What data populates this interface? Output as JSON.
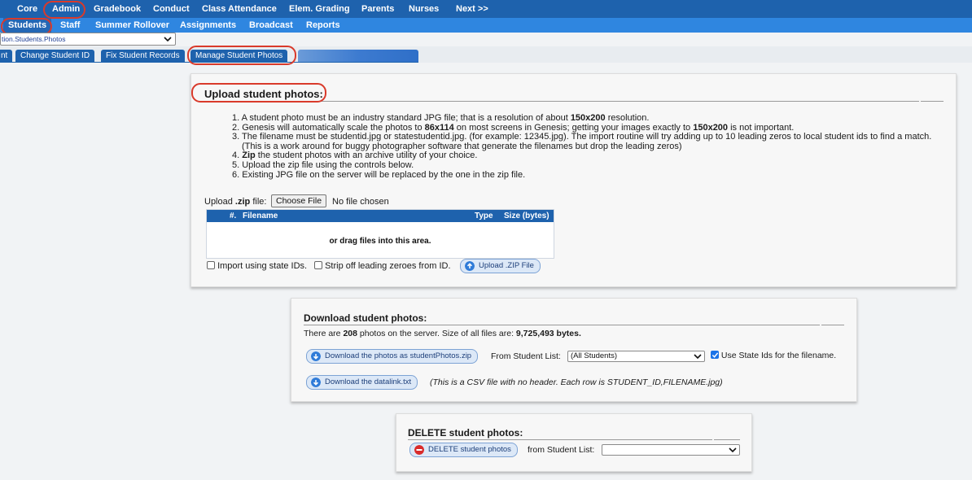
{
  "topnav": {
    "items": [
      "Core",
      "Admin",
      "Gradebook",
      "Conduct",
      "Class Attendance",
      "Elem. Grading",
      "Parents",
      "Nurses",
      "Next >>"
    ]
  },
  "subnav": {
    "items": [
      "Students",
      "Staff",
      "Summer Rollover",
      "Assignments",
      "Broadcast",
      "Reports"
    ]
  },
  "page_select": {
    "value": "tion.Students.Photos"
  },
  "tabs": [
    "nt",
    "Change Student ID",
    "Fix Student Records",
    "Manage Student Photos"
  ],
  "upload": {
    "title": "Upload student photos:",
    "rules": [
      {
        "n": "1. ",
        "parts": [
          [
            "A student photo must be an industry standard JPG file; that is a resolution of about ",
            false
          ],
          [
            "150x200",
            true
          ],
          [
            " resolution.",
            false
          ]
        ]
      },
      {
        "n": "2. ",
        "parts": [
          [
            "Genesis will automatically scale the photos to ",
            false
          ],
          [
            "86x114",
            true
          ],
          [
            " on most screens in Genesis; getting your images exactly to ",
            false
          ],
          [
            "150x200",
            true
          ],
          [
            " is not important.",
            false
          ]
        ]
      },
      {
        "n": "3. ",
        "parts": [
          [
            "The filename must be studentid.jpg or statestudentid.jpg. (for example: 12345.jpg). The import routine will try adding up to 10 leading zeros to local student ids to find a match.",
            false
          ]
        ]
      },
      {
        "n": "",
        "parts": [
          [
            "(This is a work around for buggy photographer software that generate the filenames but drop the leading zeros)",
            false
          ]
        ]
      },
      {
        "n": "4. ",
        "parts": [
          [
            "Zip",
            true
          ],
          [
            " the student photos with an archive utility of your choice.",
            false
          ]
        ]
      },
      {
        "n": "5. ",
        "parts": [
          [
            "Upload the zip file using the controls below.",
            false
          ]
        ]
      },
      {
        "n": "6. ",
        "parts": [
          [
            "Existing JPG file on the server will be replaced by the one in the zip file.",
            false
          ]
        ]
      }
    ],
    "file_label_pre": "Upload ",
    "file_label_bold": ".zip",
    "file_label_post": " file:",
    "choose_file": "Choose File",
    "no_file": "No file chosen",
    "table_headers": {
      "num": "#.",
      "filename": "Filename",
      "type": "Type",
      "size": "Size (bytes)"
    },
    "drag_text": "or drag files into this area.",
    "import_state_label": "Import using state IDs.",
    "strip_zeroes_label": "Strip off leading zeroes from ID.",
    "upload_button": "Upload .ZIP File"
  },
  "download": {
    "title": "Download student photos:",
    "info_pre": "There are ",
    "photo_count": "208",
    "info_mid": " photos on the server. Size of all files are: ",
    "size": "9,725,493 bytes.",
    "zip_button": "Download the photos as studentPhotos.zip",
    "from_list_label": "From Student List:",
    "from_list_value": "(All Students)",
    "use_state_ids_label": "Use State Ids for the filename.",
    "use_state_ids_checked": true,
    "datalink_button": "Download the datalink.txt",
    "datalink_note": "(This is a CSV file with no header. Each row is STUDENT_ID,FILENAME.jpg)"
  },
  "delete": {
    "title": "DELETE student photos:",
    "button": "DELETE student photos",
    "from_list_label": "from Student List:",
    "from_list_value": ""
  },
  "colors": {
    "nav": "#1e62ad",
    "subnav": "#2f86e0",
    "highlight_ring": "#d93a2b"
  }
}
